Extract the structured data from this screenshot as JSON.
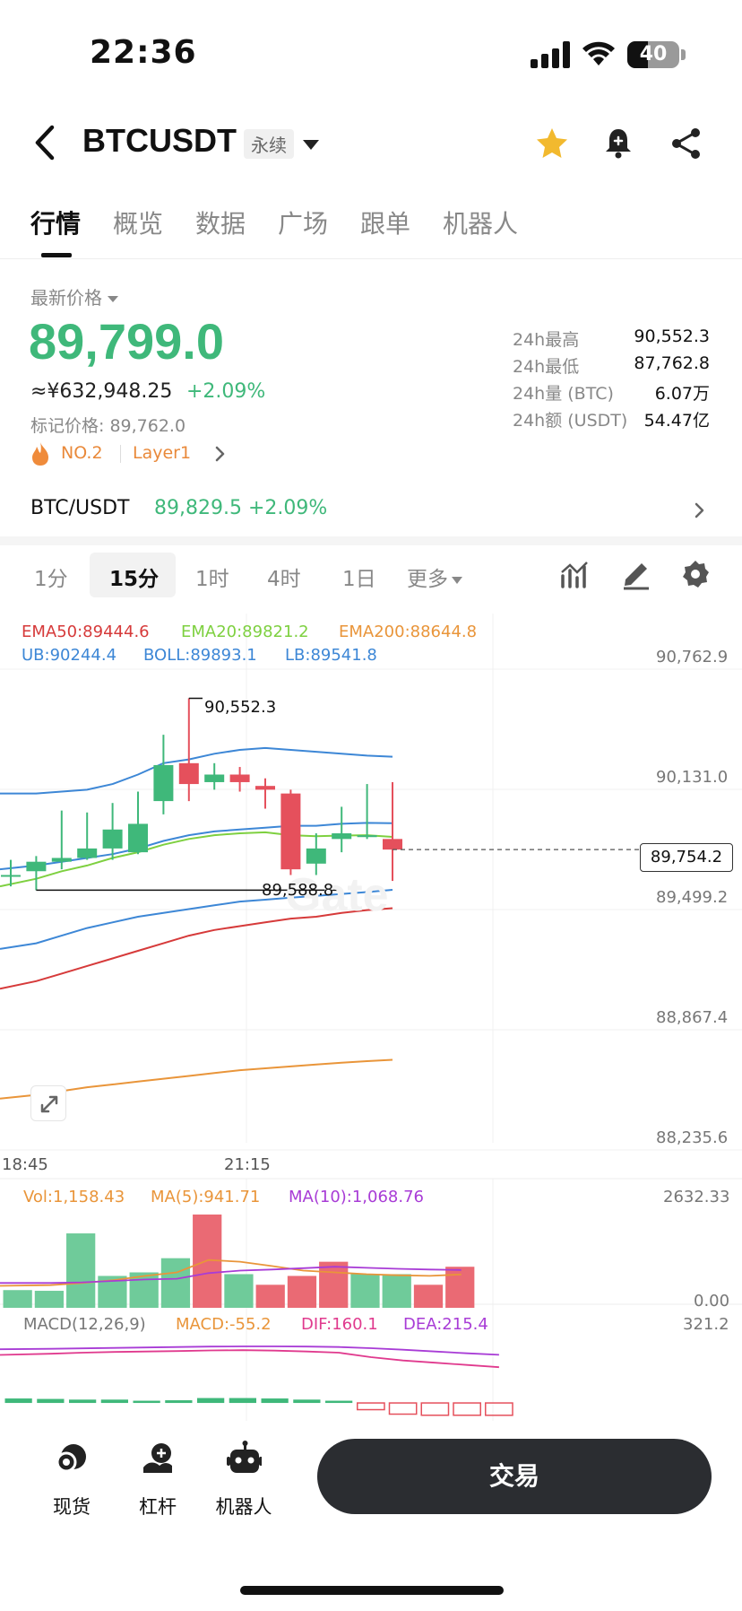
{
  "status_bar": {
    "time": "22:36",
    "battery": "40",
    "battery_level": 0.4
  },
  "header": {
    "title": "BTCUSDT",
    "badge": "永续"
  },
  "tabs": [
    {
      "label": "行情",
      "active": true
    },
    {
      "label": "概览",
      "active": false
    },
    {
      "label": "数据",
      "active": false
    },
    {
      "label": "广场",
      "active": false
    },
    {
      "label": "跟单",
      "active": false
    },
    {
      "label": "机器人",
      "active": false
    }
  ],
  "ticker": {
    "latest_label": "最新价格",
    "last_price": "89,799.0",
    "cny_price": "≈¥632,948.25",
    "change_pct": "+2.09%",
    "mark_price": "标记价格: 89,762.0",
    "rank": "NO.2",
    "tag": "Layer1"
  },
  "stats": [
    {
      "label": "24h最高",
      "value": "90,552.3"
    },
    {
      "label": "24h最低",
      "value": "87,762.8"
    },
    {
      "label": "24h量 (BTC)",
      "value": "6.07万"
    },
    {
      "label": "24h额 (USDT)",
      "value": "54.47亿"
    }
  ],
  "spot": {
    "pair": "BTC/USDT",
    "price": "89,829.5 +2.09%"
  },
  "timeframes": [
    {
      "label": "1分",
      "active": false
    },
    {
      "label": "15分",
      "active": true
    },
    {
      "label": "1时",
      "active": false
    },
    {
      "label": "4时",
      "active": false
    },
    {
      "label": "1日",
      "active": false
    },
    {
      "label": "更多",
      "active": false
    }
  ],
  "colors": {
    "up": "#3fb87a",
    "down": "#e5505c",
    "ema50": "#d63a3a",
    "ema20": "#7ed040",
    "ema200": "#e9953a",
    "boll": "#3d87d6",
    "ma10": "#a83cd6",
    "macd_dif": "#e03a8e"
  },
  "chart_data": [
    {
      "type": "candlestick",
      "indicators": {
        "ema": [
          "EMA50:89444.6",
          "EMA20:89821.2",
          "EMA200:88644.8"
        ],
        "boll": [
          "UB:90244.4",
          "BOLL:89893.1",
          "LB:89541.8"
        ]
      },
      "y_ticks": [
        "90,762.9",
        "90,131.0",
        "89,499.2",
        "88,867.4",
        "88,235.6"
      ],
      "ylim": [
        88235.6,
        90762.9
      ],
      "x_ticks": [
        "18:45",
        "21:15"
      ],
      "high_label": "90,552.3",
      "low_label": "89,588.8",
      "current_price": "89,754.2",
      "candles": [
        {
          "o": 89620,
          "h": 89700,
          "l": 89560,
          "c": 89620
        },
        {
          "o": 89640,
          "h": 89720,
          "l": 89540,
          "c": 89690
        },
        {
          "o": 89690,
          "h": 89960,
          "l": 89650,
          "c": 89710
        },
        {
          "o": 89710,
          "h": 89950,
          "l": 89700,
          "c": 89760
        },
        {
          "o": 89760,
          "h": 90000,
          "l": 89700,
          "c": 89860
        },
        {
          "o": 89740,
          "h": 90060,
          "l": 89730,
          "c": 89890
        },
        {
          "o": 90010,
          "h": 90360,
          "l": 89940,
          "c": 90200
        },
        {
          "o": 90210,
          "h": 90552.3,
          "l": 90010,
          "c": 90100
        },
        {
          "o": 90110,
          "h": 90210,
          "l": 90070,
          "c": 90150
        },
        {
          "o": 90150,
          "h": 90190,
          "l": 90060,
          "c": 90110
        },
        {
          "o": 90090,
          "h": 90130,
          "l": 89970,
          "c": 90070
        },
        {
          "o": 90050,
          "h": 90070,
          "l": 89620,
          "c": 89650
        },
        {
          "o": 89680,
          "h": 89840,
          "l": 89620,
          "c": 89760
        },
        {
          "o": 89810,
          "h": 89980,
          "l": 89740,
          "c": 89840
        },
        {
          "o": 89820,
          "h": 90100,
          "l": 89810,
          "c": 89830
        },
        {
          "o": 89810,
          "h": 90110,
          "l": 89588.8,
          "c": 89754.2
        }
      ],
      "series": [
        {
          "key": "ub",
          "values": [
            90050,
            90050,
            90060,
            90070,
            90100,
            90150,
            90210,
            90230,
            90260,
            90280,
            90290,
            90280,
            90270,
            90260,
            90250,
            90244.4
          ]
        },
        {
          "key": "boll",
          "values": [
            89650,
            89670,
            89690,
            89710,
            89730,
            89760,
            89800,
            89830,
            89850,
            89860,
            89870,
            89880,
            89880,
            89890,
            89895,
            89893.1
          ]
        },
        {
          "key": "lb",
          "values": [
            89230,
            89260,
            89300,
            89340,
            89370,
            89400,
            89420,
            89440,
            89460,
            89480,
            89490,
            89500,
            89510,
            89520,
            89530,
            89541.8
          ]
        },
        {
          "key": "ema20",
          "values": [
            89560,
            89600,
            89640,
            89670,
            89710,
            89740,
            89780,
            89810,
            89830,
            89840,
            89845,
            89830,
            89825,
            89828,
            89830,
            89821.2
          ]
        },
        {
          "key": "ema50",
          "values": [
            89020,
            89060,
            89100,
            89140,
            89180,
            89220,
            89260,
            89300,
            89330,
            89350,
            89370,
            89390,
            89400,
            89420,
            89435,
            89444.6
          ]
        },
        {
          "key": "ema200",
          "values": [
            88440,
            88460,
            88480,
            88500,
            88515,
            88530,
            88545,
            88560,
            88575,
            88590,
            88600,
            88610,
            88620,
            88630,
            88638,
            88644.8
          ]
        }
      ]
    },
    {
      "type": "bar",
      "indicators": [
        "Vol:1,158.43",
        "MA(5):941.71",
        "MA(10):1,068.76"
      ],
      "y_ticks": [
        "2632.33",
        "0.00"
      ],
      "ylim": [
        0,
        2632.33
      ],
      "values": [
        500,
        480,
        2100,
        900,
        1000,
        1400,
        2632.33,
        950,
        650,
        900,
        1300,
        950,
        950,
        650,
        1158.43
      ],
      "up": [
        true,
        true,
        true,
        true,
        true,
        true,
        false,
        true,
        false,
        false,
        false,
        true,
        true,
        false,
        false
      ],
      "ma5": [
        620,
        640,
        700,
        780,
        900,
        1000,
        1350,
        1300,
        1180,
        1050,
        1000,
        950,
        920,
        900,
        941.71
      ],
      "ma10": [
        700,
        700,
        720,
        760,
        800,
        820,
        980,
        1050,
        1080,
        1120,
        1160,
        1130,
        1100,
        1080,
        1068.76
      ]
    },
    {
      "type": "bar",
      "indicators": [
        "MACD(12,26,9)",
        "MACD:-55.2",
        "DIF:160.1",
        "DEA:215.4"
      ],
      "y_ticks": [
        "321.2"
      ],
      "ylim": [
        -80,
        321.2
      ],
      "values": [
        20,
        18,
        15,
        15,
        10,
        12,
        22,
        22,
        20,
        15,
        10,
        -30,
        -50,
        -55,
        -55,
        -55.2
      ],
      "dif": [
        215,
        220,
        225,
        228,
        230,
        232,
        235,
        236,
        234,
        230,
        225,
        205,
        190,
        180,
        170,
        160.1
      ],
      "dea": [
        240,
        242,
        244,
        246,
        248,
        250,
        252,
        253,
        253,
        252,
        250,
        245,
        238,
        230,
        222,
        215.4
      ]
    }
  ],
  "bottom_nav": [
    {
      "label": "现货"
    },
    {
      "label": "杠杆"
    },
    {
      "label": "机器人"
    }
  ],
  "trade_button": "交易"
}
